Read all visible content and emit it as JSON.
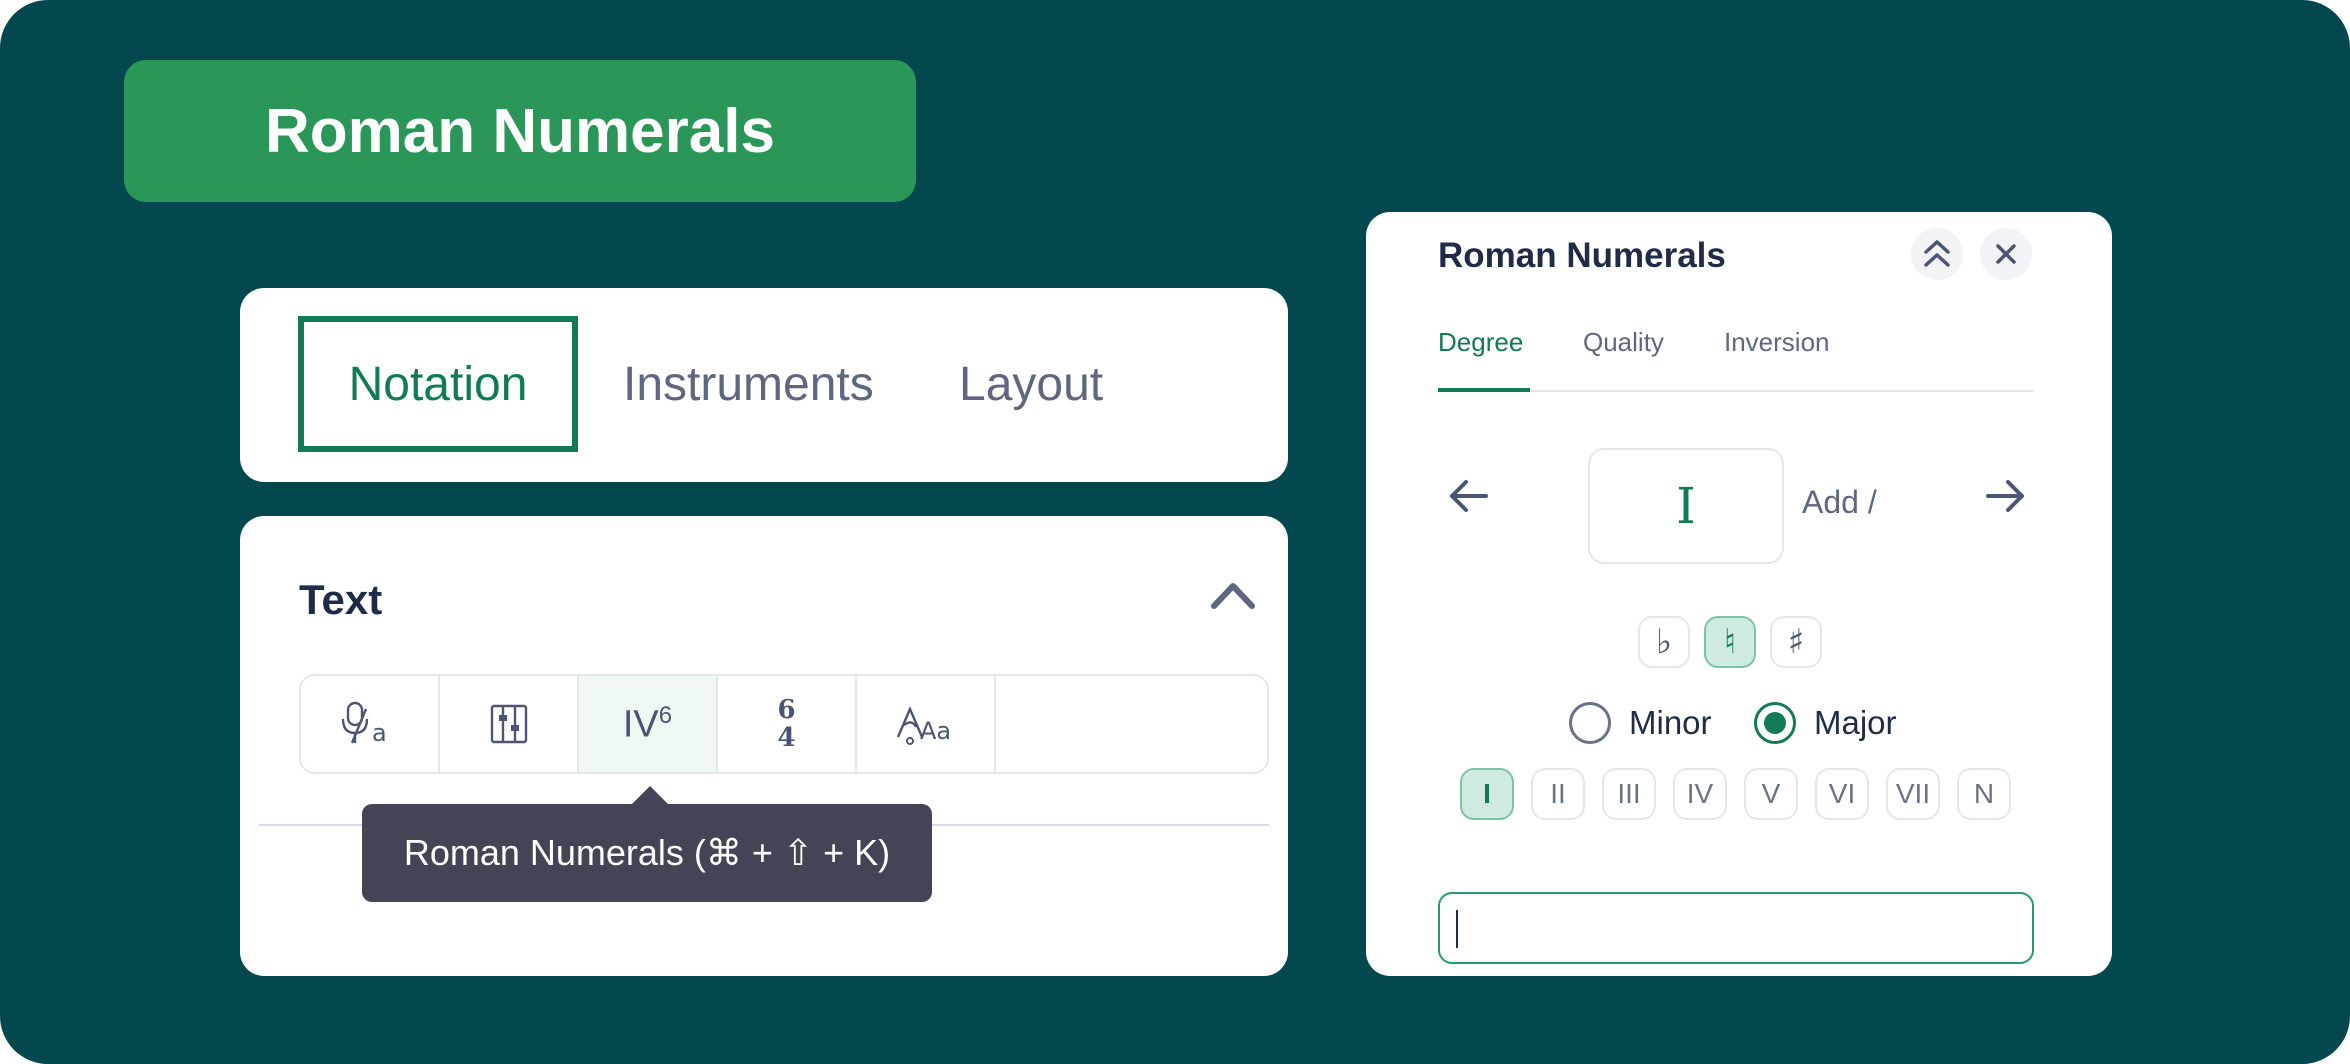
{
  "badge": {
    "title": "Roman Numerals"
  },
  "tabs": [
    {
      "label": "Notation",
      "active": true
    },
    {
      "label": "Instruments",
      "active": false
    },
    {
      "label": "Layout",
      "active": false
    }
  ],
  "text_panel": {
    "title": "Text",
    "tools": [
      {
        "icon": "lyrics-text-icon"
      },
      {
        "icon": "chord-frame-icon"
      },
      {
        "icon": "roman-numeral-icon",
        "label": "IV",
        "sup": "6",
        "active": true
      },
      {
        "icon": "figured-bass-icon",
        "top": "6",
        "bottom": "4"
      },
      {
        "icon": "staff-text-icon"
      }
    ],
    "tooltip": "Roman Numerals (⌘ + ⇧ + K)"
  },
  "dialog": {
    "title": "Roman Numerals",
    "tabs": [
      "Degree",
      "Quality",
      "Inversion"
    ],
    "active_tab": "Degree",
    "degree_value": "I",
    "add_slash": "Add /",
    "accidentals": [
      {
        "symbol": "♭",
        "active": false
      },
      {
        "symbol": "♮",
        "active": true
      },
      {
        "symbol": "♯",
        "active": false
      }
    ],
    "modes": [
      {
        "label": "Minor",
        "selected": false
      },
      {
        "label": "Major",
        "selected": true
      }
    ],
    "degrees": [
      "I",
      "II",
      "III",
      "IV",
      "V",
      "VI",
      "VII",
      "N"
    ],
    "active_degree": "I",
    "input_value": ""
  },
  "colors": {
    "background": "#03474f",
    "badge": "#2a9658",
    "accent": "#127a55",
    "tooltip": "#434556"
  }
}
